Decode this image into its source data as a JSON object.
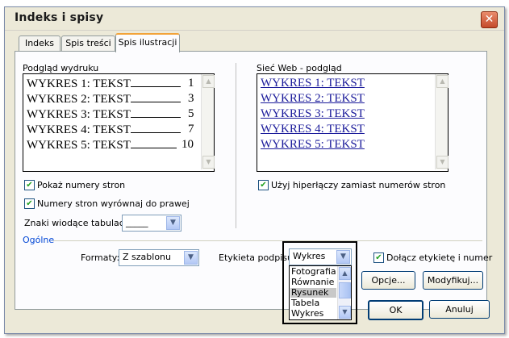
{
  "window": {
    "title": "Indeks i spisy"
  },
  "tabs": [
    {
      "label": "Indeks"
    },
    {
      "label": "Spis treści"
    },
    {
      "label": "Spis ilustracji"
    }
  ],
  "print_preview": {
    "label": "Podgląd wydruku",
    "lines": [
      {
        "text": "WYKRES 1: TEKST",
        "page": "1"
      },
      {
        "text": "WYKRES 2: TEKST",
        "page": "3"
      },
      {
        "text": "WYKRES 3: TEKST",
        "page": "5"
      },
      {
        "text": "WYKRES 4: TEKST",
        "page": "7"
      },
      {
        "text": "WYKRES 5: TEKST",
        "page": "10"
      }
    ]
  },
  "web_preview": {
    "label": "Sieć Web - podgląd",
    "links": [
      "WYKRES 1: TEKST",
      "WYKRES 2: TEKST",
      "WYKRES 3: TEKST",
      "WYKRES 4: TEKST",
      "WYKRES 5: TEKST"
    ]
  },
  "options": {
    "show_page_numbers": "Pokaż numery stron",
    "align_right": "Numery stron wyrównaj do prawej",
    "use_hyperlinks": "Użyj hiperłączy zamiast numerów stron",
    "tab_leader_label": "Znaki wiodące tabulacji:",
    "tab_leader_value": "_____"
  },
  "general": {
    "section_label": "Ogólne",
    "formats_label": "Formaty:",
    "formats_value": "Z szablonu",
    "caption_label": "Etykieta podpisu:",
    "caption_value": "Wykres",
    "caption_options": [
      "Fotografia",
      "Równanie",
      "Rysunek",
      "Tabela",
      "Wykres"
    ],
    "include_label": "Dołącz etykietę i numer"
  },
  "buttons": {
    "options": "Opcje...",
    "modify": "Modyfikuj...",
    "ok": "OK",
    "cancel": "Anuluj"
  },
  "icons": {
    "check": "✔",
    "arrow_down": "▼",
    "arrow_up": "▲",
    "close": "✕"
  }
}
